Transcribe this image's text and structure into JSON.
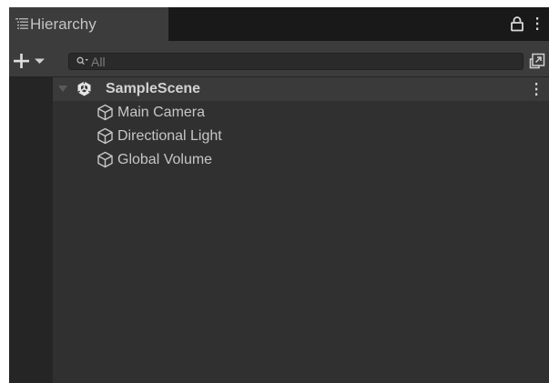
{
  "tab": {
    "title": "Hierarchy",
    "icon": "hierarchy-list-icon"
  },
  "toolbar": {
    "add_icon": "plus-icon",
    "add_dropdown_icon": "caret-down-icon",
    "search": {
      "value": "",
      "placeholder": "All",
      "icon": "search-filter-icon"
    },
    "scene_visibility_icon": "scene-visibility-icon"
  },
  "tree": {
    "scene": {
      "label": "SampleScene",
      "icon": "unity-scene-icon",
      "expanded": true
    },
    "items": [
      {
        "label": "Main Camera",
        "icon": "gameobject-cube-icon"
      },
      {
        "label": "Directional Light",
        "icon": "gameobject-cube-icon"
      },
      {
        "label": "Global Volume",
        "icon": "gameobject-cube-icon"
      }
    ]
  },
  "colors": {
    "tab_bg": "#3c3c3c",
    "tabbar_bg": "#191919",
    "toolbar_bg": "#3c3c3c",
    "tree_bg": "#303030",
    "gutter_bg": "#252525",
    "scene_row_bg": "#3a3a3a",
    "text": "#c6c6c6",
    "placeholder": "#7d7d7d"
  }
}
